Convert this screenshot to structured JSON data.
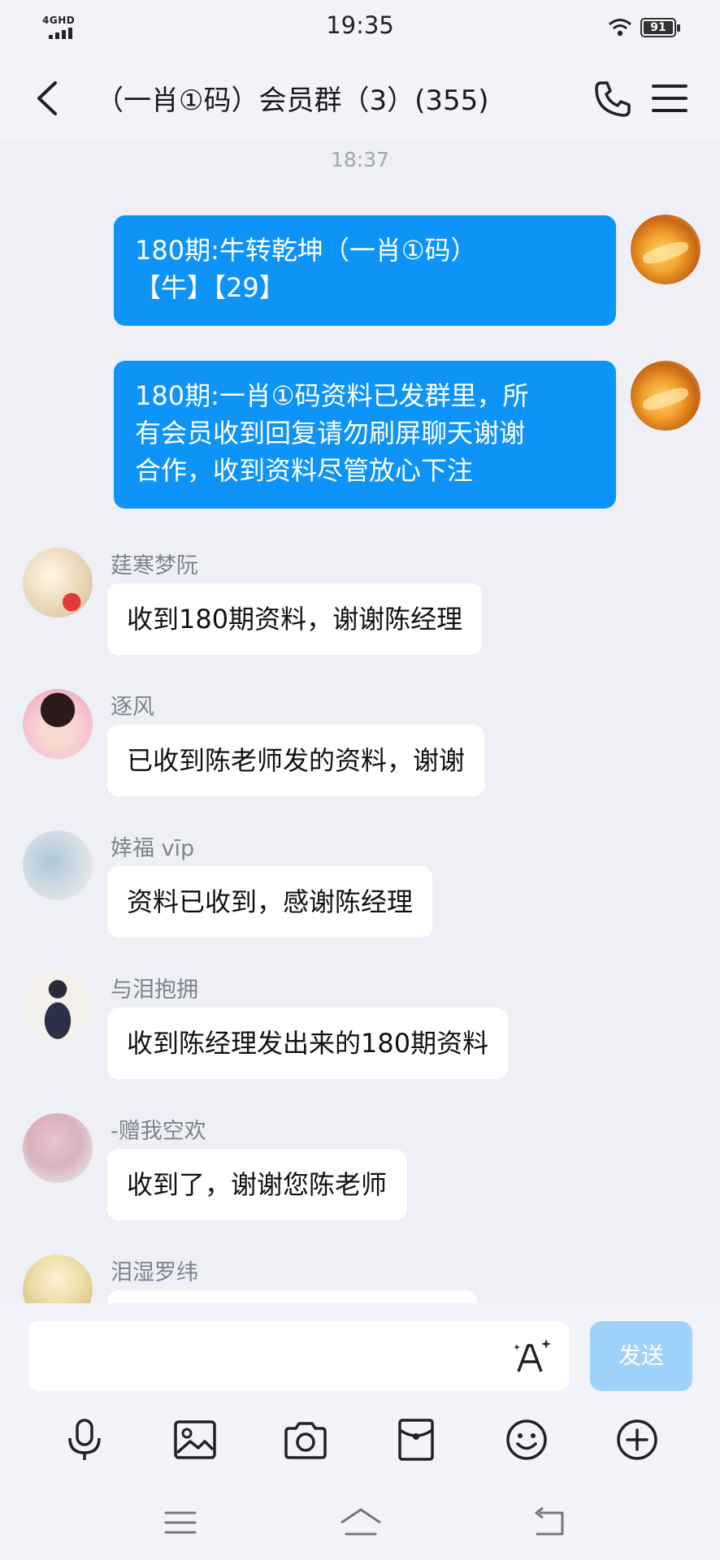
{
  "status_bar": {
    "network": "4GHD",
    "time": "19:35",
    "battery": "91"
  },
  "header": {
    "title": "（一肖①码）会员群（3）(355)"
  },
  "messages": {
    "timestamp": "18:37",
    "outgoing": [
      {
        "text_line1": "180期:牛转乾坤（一肖①码）",
        "text_line2": "【牛】【29】"
      },
      {
        "text_line1": "180期:一肖①码资料已发群里，所",
        "text_line2": "有会员收到回复请勿刷屏聊天谢谢",
        "text_line3": "合作，收到资料尽管放心下注"
      }
    ],
    "incoming": [
      {
        "sender": "莛寒梦阮",
        "text": "收到180期资料，谢谢陈经理"
      },
      {
        "sender": "逐风",
        "text": "已收到陈老师发的资料，谢谢"
      },
      {
        "sender": "婞福 vīp",
        "text": "资料已收到，感谢陈经理"
      },
      {
        "sender": "与泪抱拥",
        "text": "收到陈经理发出来的180期资料"
      },
      {
        "sender": "-赠我空欢",
        "text": "收到了，谢谢您陈老师"
      },
      {
        "sender": "泪湿罗纬",
        "text": ""
      }
    ]
  },
  "composer": {
    "send_label": "发送",
    "input_value": ""
  },
  "colors": {
    "outgoing_bubble": "#0e93f7",
    "send_disabled": "#9fd2fb",
    "background": "#eef0f6"
  }
}
